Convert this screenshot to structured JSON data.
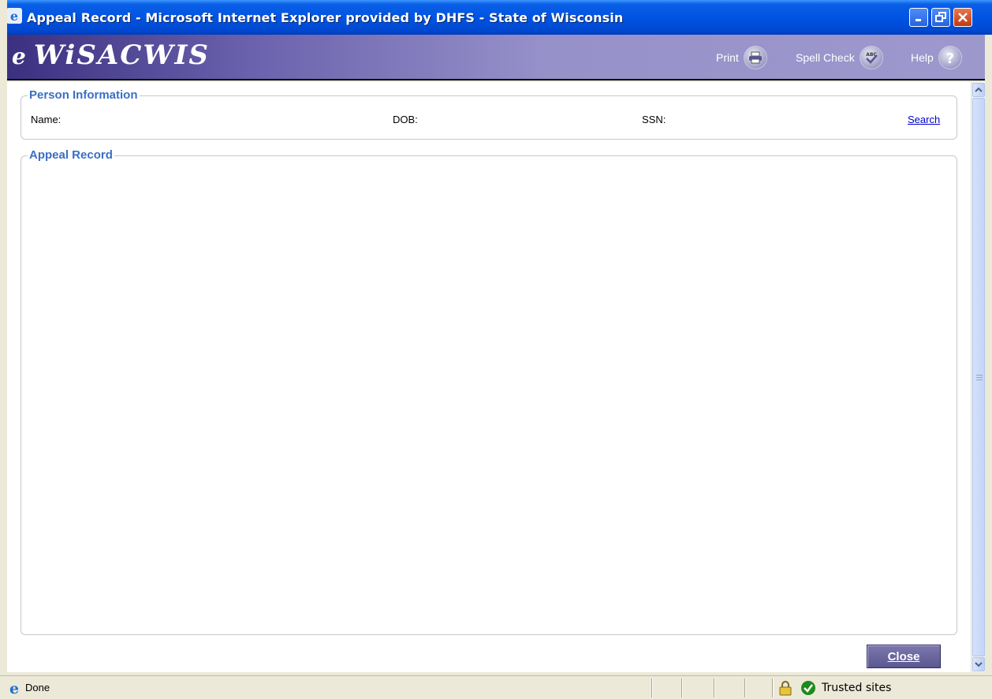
{
  "window": {
    "title": "Appeal Record - Microsoft Internet Explorer provided by DHFS - State of Wisconsin"
  },
  "banner": {
    "brand_prefix": "e",
    "brand_name": "WiSACWIS",
    "print_label": "Print",
    "spellcheck_label": "Spell Check",
    "help_label": "Help"
  },
  "person_info": {
    "legend": "Person Information",
    "name_label": "Name:",
    "dob_label": "DOB:",
    "ssn_label": "SSN:",
    "search_link": "Search"
  },
  "appeal_record": {
    "legend": "Appeal Record"
  },
  "actions": {
    "close_label": "Close"
  },
  "statusbar": {
    "status": "Done",
    "zone": "Trusted sites"
  },
  "icons": {
    "ie": "internet-explorer-icon",
    "print": "printer-icon",
    "spellcheck": "spell-check-icon",
    "help": "help-icon",
    "lock": "lock-icon",
    "trusted": "trusted-sites-icon"
  },
  "colors": {
    "title_bar": "#0054e3",
    "banner_dark": "#3b3080",
    "banner_light": "#9d98cc",
    "legend_text": "#3a6fc3",
    "link": "#0000cc",
    "button": "#5a5690"
  }
}
